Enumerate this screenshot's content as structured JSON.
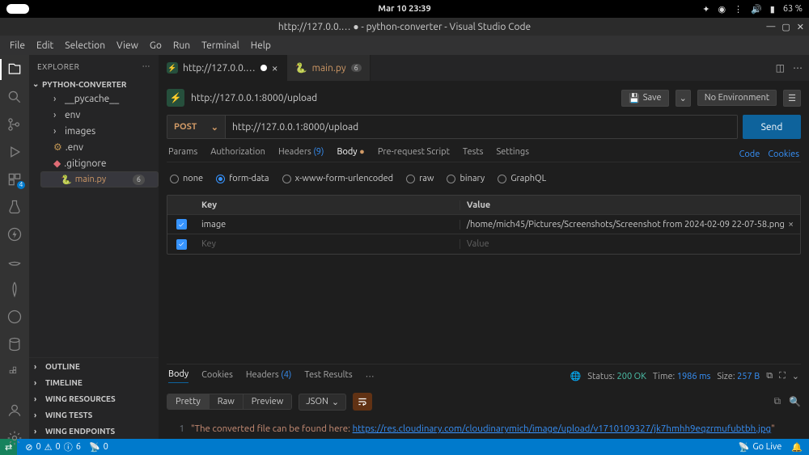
{
  "os": {
    "date": "Mar 10  23:39",
    "battery": "63 %"
  },
  "window": {
    "title": "http://127.0.0.… ● - python-converter - Visual Studio Code"
  },
  "menu": [
    "File",
    "Edit",
    "Selection",
    "View",
    "Go",
    "Run",
    "Terminal",
    "Help"
  ],
  "explorer": {
    "title": "EXPLORER",
    "project": "PYTHON-CONVERTER",
    "tree": [
      {
        "label": "__pycache__",
        "kind": "folder"
      },
      {
        "label": "env",
        "kind": "folder"
      },
      {
        "label": "images",
        "kind": "folder"
      },
      {
        "label": ".env",
        "kind": "file"
      },
      {
        "label": ".gitignore",
        "kind": "file"
      },
      {
        "label": "main.py",
        "kind": "file",
        "badge": "6",
        "selected": true
      }
    ],
    "sections": [
      "OUTLINE",
      "TIMELINE",
      "WING RESOURCES",
      "WING TESTS",
      "WING ENDPOINTS"
    ]
  },
  "tabs": [
    {
      "label": "http://127.0.0.…",
      "modified": true,
      "active": true,
      "icon": "tc"
    },
    {
      "label": "main.py",
      "badge": "6",
      "icon": "py"
    }
  ],
  "tc": {
    "url": "http://127.0.0.1:8000/upload",
    "save": "Save",
    "env": "No Environment",
    "method": "POST",
    "input": "http://127.0.0.1:8000/upload",
    "send": "Send",
    "reqTabs": {
      "params": "Params",
      "auth": "Authorization",
      "headers": "Headers",
      "headers_n": "(9)",
      "body": "Body",
      "pre": "Pre-request Script",
      "tests": "Tests",
      "settings": "Settings",
      "code": "Code",
      "cookies": "Cookies"
    },
    "bodyTypes": {
      "none": "none",
      "form": "form-data",
      "xwww": "x-www-form-urlencoded",
      "raw": "raw",
      "binary": "binary",
      "graphql": "GraphQL"
    },
    "table": {
      "key_h": "Key",
      "val_h": "Value",
      "rows": [
        {
          "checked": true,
          "key": "image",
          "value": "/home/mich45/Pictures/Screenshots/Screenshot from 2024-02-09 22-07-58.png"
        },
        {
          "checked": true,
          "key": "",
          "value": "",
          "placeholderKey": "Key",
          "placeholderVal": "Value"
        }
      ]
    }
  },
  "resp": {
    "tabs": {
      "body": "Body",
      "cookies": "Cookies",
      "headers": "Headers",
      "headers_n": "(4)",
      "tests": "Test Results"
    },
    "status_label": "Status:",
    "status": "200 OK",
    "time_label": "Time:",
    "time": "1986 ms",
    "size_label": "Size:",
    "size": "257 B",
    "view": {
      "pretty": "Pretty",
      "raw": "Raw",
      "preview": "Preview",
      "format": "JSON"
    },
    "line": "1",
    "text_pre": "\"The converted file can be found here: ",
    "text_url": "https://res.cloudinary.com/cloudinarymich/image/upload/v1710109327/jk7hmhh9eqzrmufubtbh.jpg",
    "text_post": "\""
  },
  "status": {
    "errors": "0",
    "warnings": "0",
    "ports": "6",
    "fwd": "0",
    "golive": "Go Live"
  }
}
